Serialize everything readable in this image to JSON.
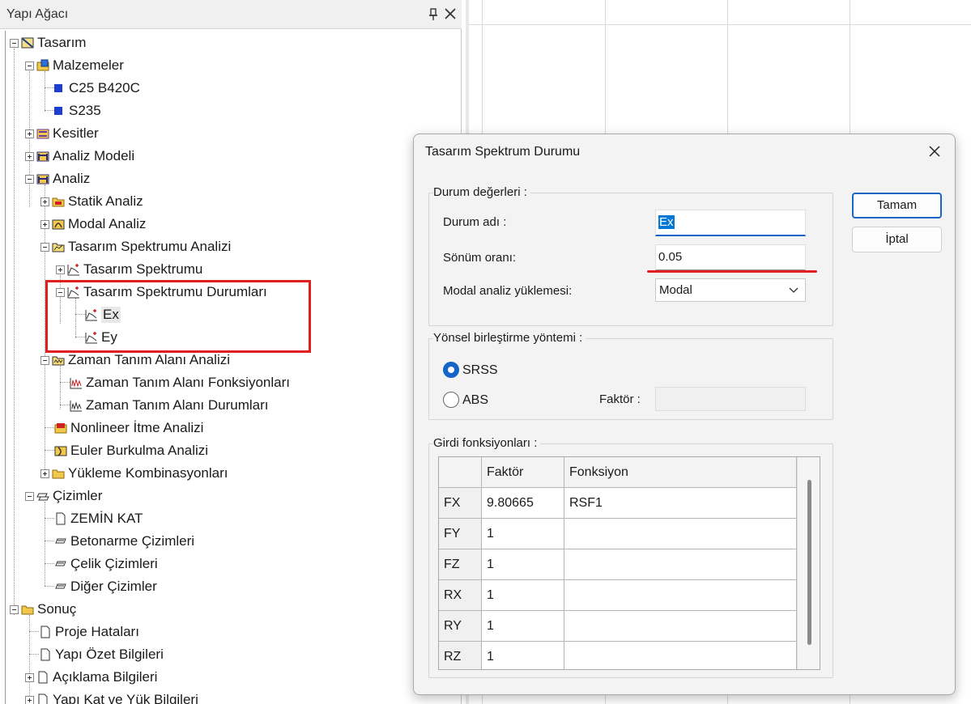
{
  "tree_panel": {
    "title": "Yapı Ağacı",
    "nodes": [
      {
        "label": "Tasarım",
        "icon": "design-icon"
      },
      {
        "label": "Malzemeler",
        "icon": "materials-icon"
      },
      {
        "label": "C25 B420C",
        "icon": "material-square-icon"
      },
      {
        "label": "S235",
        "icon": "material-square-icon"
      },
      {
        "label": "Kesitler",
        "icon": "sections-icon"
      },
      {
        "label": "Analiz Modeli",
        "icon": "analysis-model-icon"
      },
      {
        "label": "Analiz",
        "icon": "analysis-icon"
      },
      {
        "label": "Statik Analiz",
        "icon": "folder-icon"
      },
      {
        "label": "Modal Analiz",
        "icon": "modal-icon"
      },
      {
        "label": "Tasarım Spektrumu Analizi",
        "icon": "folder-open-icon"
      },
      {
        "label": "Tasarım Spektrumu",
        "icon": "spectrum-chart-icon"
      },
      {
        "label": "Tasarım Spektrumu Durumları",
        "icon": "spectrum-chart-icon"
      },
      {
        "label": "Ex",
        "icon": "spectrum-chart-icon"
      },
      {
        "label": "Ey",
        "icon": "spectrum-chart-icon"
      },
      {
        "label": "Zaman Tanım Alanı Analizi",
        "icon": "time-history-folder-icon"
      },
      {
        "label": "Zaman Tanım Alanı Fonksiyonları",
        "icon": "time-function-icon"
      },
      {
        "label": "Zaman Tanım Alanı Durumları",
        "icon": "time-case-icon"
      },
      {
        "label": "Nonlineer İtme Analizi",
        "icon": "pushover-icon"
      },
      {
        "label": "Euler Burkulma Analizi",
        "icon": "buckling-icon"
      },
      {
        "label": "Yükleme Kombinasyonları",
        "icon": "folder-icon"
      },
      {
        "label": "Çizimler",
        "icon": "drawings-icon"
      },
      {
        "label": "ZEMİN KAT",
        "icon": "page-icon"
      },
      {
        "label": "Betonarme Çizimleri",
        "icon": "drawing-sheet-icon"
      },
      {
        "label": "Çelik Çizimleri",
        "icon": "drawing-sheet-icon"
      },
      {
        "label": "Diğer Çizimler",
        "icon": "drawing-sheet-icon"
      },
      {
        "label": "Sonuç",
        "icon": "folder-icon"
      },
      {
        "label": "Proje Hataları",
        "icon": "page-icon"
      },
      {
        "label": "Yapı Özet Bilgileri",
        "icon": "page-icon"
      },
      {
        "label": "Açıklama Bilgileri",
        "icon": "page-icon"
      },
      {
        "label": "Yapı Kat ve Yük Bilgileri",
        "icon": "page-icon"
      }
    ]
  },
  "dialog": {
    "title": "Tasarım Spektrum Durumu",
    "ok_label": "Tamam",
    "cancel_label": "İptal",
    "case_values": {
      "group_label": "Durum değerleri :",
      "name_label": "Durum adı :",
      "name_value": "Ex",
      "damping_label": "Sönüm oranı:",
      "damping_value": "0.05",
      "modal_label": "Modal analiz yüklemesi:",
      "modal_value": "Modal"
    },
    "combination": {
      "group_label": "Yönsel birleştirme yöntemi :",
      "srss_label": "SRSS",
      "abs_label": "ABS",
      "factor_label": "Faktör :",
      "factor_value": ""
    },
    "input_functions": {
      "group_label": "Girdi fonksiyonları :",
      "col_factor": "Faktör",
      "col_function": "Fonksiyon",
      "rows": [
        {
          "dir": "FX",
          "factor": "9.80665",
          "function": "RSF1"
        },
        {
          "dir": "FY",
          "factor": "1",
          "function": ""
        },
        {
          "dir": "FZ",
          "factor": "1",
          "function": ""
        },
        {
          "dir": "RX",
          "factor": "1",
          "function": ""
        },
        {
          "dir": "RY",
          "factor": "1",
          "function": ""
        },
        {
          "dir": "RZ",
          "factor": "1",
          "function": ""
        }
      ]
    }
  },
  "colors": {
    "accent": "#1564c8",
    "highlight": "#e0201e"
  }
}
